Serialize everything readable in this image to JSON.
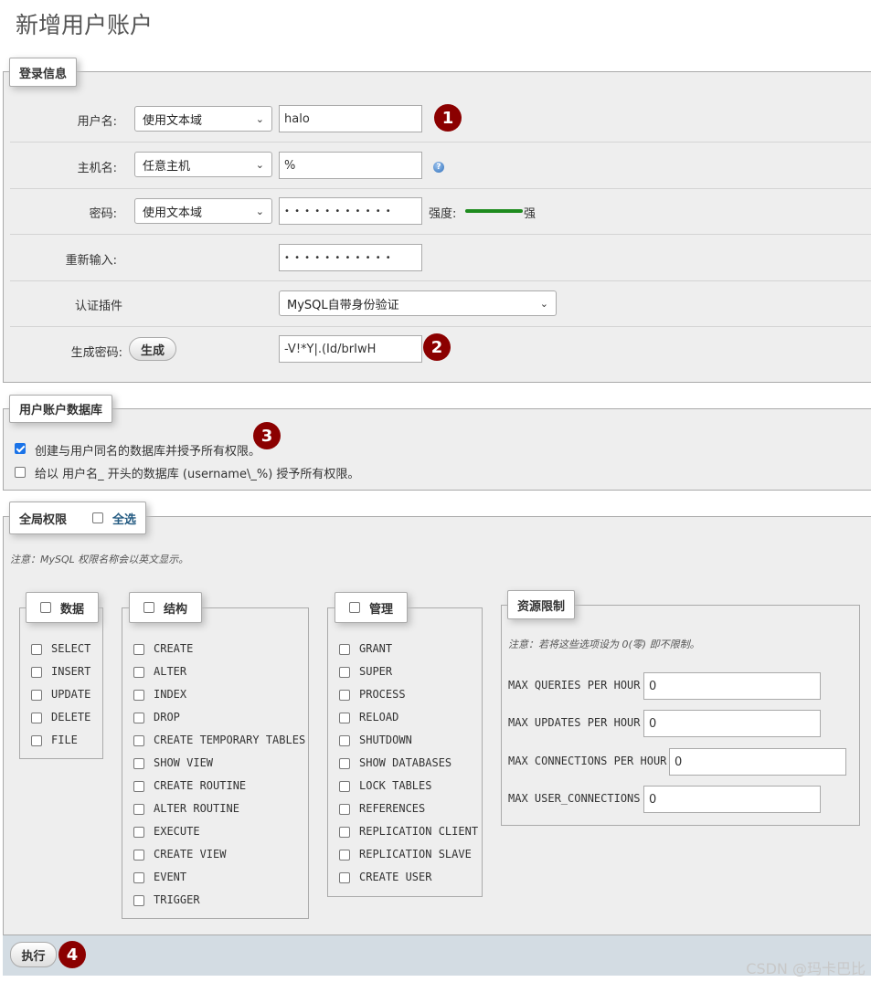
{
  "page": {
    "title": "新增用户账户"
  },
  "login": {
    "legend": "登录信息",
    "username": {
      "label": "用户名:",
      "mode": "使用文本域",
      "value": "halo",
      "marker": "1"
    },
    "hostname": {
      "label": "主机名:",
      "mode": "任意主机",
      "value": "%"
    },
    "password": {
      "label": "密码:",
      "mode": "使用文本域",
      "value": "• • • • • • • • • • •",
      "strength_label": "强度:",
      "strength_value": "强"
    },
    "reenter": {
      "label": "重新输入:",
      "value": "• • • • • • • • • • •"
    },
    "auth_plugin": {
      "label": "认证插件",
      "value": "MySQL自带身份验证"
    },
    "generate": {
      "label": "生成密码:",
      "button": "生成",
      "value": "-V!*Y|.(Id/brIwH",
      "marker": "2"
    }
  },
  "userdb": {
    "legend": "用户账户数据库",
    "option1": {
      "label": "创建与用户同名的数据库并授予所有权限。",
      "checked": true
    },
    "option2": {
      "label": "给以 用户名_ 开头的数据库 (username\\_%) 授予所有权限。",
      "checked": false
    },
    "marker": "3"
  },
  "global": {
    "legend": "全局权限",
    "select_all": "全选",
    "note": "注意：MySQL 权限名称会以英文显示。",
    "data": {
      "legend": "数据",
      "items": [
        "SELECT",
        "INSERT",
        "UPDATE",
        "DELETE",
        "FILE"
      ]
    },
    "structure": {
      "legend": "结构",
      "items": [
        "CREATE",
        "ALTER",
        "INDEX",
        "DROP",
        "CREATE TEMPORARY TABLES",
        "SHOW VIEW",
        "CREATE ROUTINE",
        "ALTER ROUTINE",
        "EXECUTE",
        "CREATE VIEW",
        "EVENT",
        "TRIGGER"
      ]
    },
    "admin": {
      "legend": "管理",
      "items": [
        "GRANT",
        "SUPER",
        "PROCESS",
        "RELOAD",
        "SHUTDOWN",
        "SHOW DATABASES",
        "LOCK TABLES",
        "REFERENCES",
        "REPLICATION CLIENT",
        "REPLICATION SLAVE",
        "CREATE USER"
      ]
    },
    "resources": {
      "legend": "资源限制",
      "note": "注意：若将这些选项设为 0(零) 即不限制。",
      "items": [
        {
          "label": "MAX QUERIES PER HOUR",
          "value": "0"
        },
        {
          "label": "MAX UPDATES PER HOUR",
          "value": "0"
        },
        {
          "label": "MAX CONNECTIONS PER HOUR",
          "value": "0"
        },
        {
          "label": "MAX USER_CONNECTIONS",
          "value": "0"
        }
      ]
    }
  },
  "footer": {
    "execute": "执行",
    "marker": "4"
  },
  "watermark": "CSDN @玛卡巴比",
  "colors": {
    "marker": "#8b0000",
    "strength": "#1e8b1e",
    "footer": "#d3dce3",
    "checkbox": "#1a73e8"
  }
}
